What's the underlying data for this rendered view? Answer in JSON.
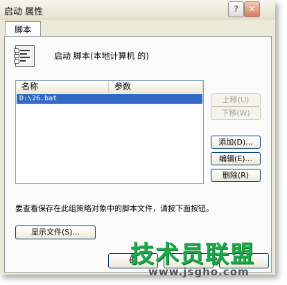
{
  "window": {
    "title": "启动 属性",
    "help_glyph": "?",
    "close_glyph": "✕"
  },
  "tabs": [
    {
      "label": "脚本"
    }
  ],
  "heading": "启动 脚本(本地计算机 的)",
  "list": {
    "columns": [
      "名称",
      "参数"
    ],
    "rows": [
      {
        "name": "D:\\26.bat",
        "params": ""
      }
    ]
  },
  "side_buttons": {
    "up": "上移(U)",
    "down": "下移(W)",
    "add": "添加(D)...",
    "edit": "编辑(E)...",
    "remove": "删除(R)"
  },
  "note": "要查看保存在此组策略对象中的脚本文件，请按下面按钮。",
  "show_files_button": "显示文件(S)...",
  "bottom_buttons": {
    "ok": "确",
    "cancel": "",
    "apply": ""
  },
  "watermark": {
    "text": "技术员联盟",
    "url": "www.jsgho.com"
  }
}
